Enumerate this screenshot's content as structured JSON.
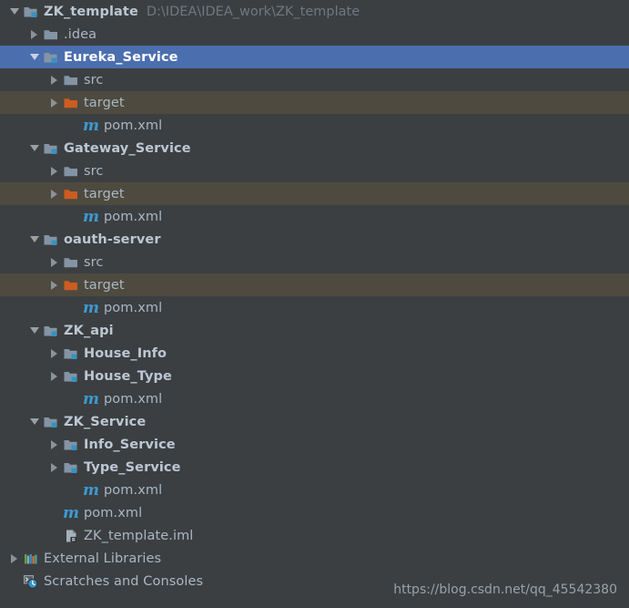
{
  "window": {
    "background_color": "#3c3f41",
    "selected_row_color": "#4b6eaf",
    "excluded_row_color": "#4e4a3f",
    "text_color": "#a9b7c6",
    "path_text_color": "#6f7780"
  },
  "watermark": "https://blog.csdn.net/qq_45542380",
  "tree": {
    "items": [
      {
        "label": "ZK_template",
        "path": "D:\\IDEA\\IDEA_work\\ZK_template",
        "icon": "module-icon",
        "depth": 0,
        "toggle": "expanded",
        "bold": true,
        "state": "normal"
      },
      {
        "label": ".idea",
        "icon": "folder-icon",
        "depth": 1,
        "toggle": "collapsed",
        "bold": false,
        "state": "normal"
      },
      {
        "label": "Eureka_Service",
        "icon": "module-icon",
        "depth": 1,
        "toggle": "expanded",
        "bold": true,
        "state": "selected"
      },
      {
        "label": "src",
        "icon": "folder-icon",
        "depth": 2,
        "toggle": "collapsed",
        "bold": false,
        "state": "normal"
      },
      {
        "label": "target",
        "icon": "folder-excluded-icon",
        "depth": 2,
        "toggle": "collapsed",
        "bold": false,
        "state": "excluded"
      },
      {
        "label": "pom.xml",
        "icon": "maven-icon",
        "depth": 3,
        "toggle": "none",
        "bold": false,
        "state": "normal"
      },
      {
        "label": "Gateway_Service",
        "icon": "module-icon",
        "depth": 1,
        "toggle": "expanded",
        "bold": true,
        "state": "normal"
      },
      {
        "label": "src",
        "icon": "folder-icon",
        "depth": 2,
        "toggle": "collapsed",
        "bold": false,
        "state": "normal"
      },
      {
        "label": "target",
        "icon": "folder-excluded-icon",
        "depth": 2,
        "toggle": "collapsed",
        "bold": false,
        "state": "excluded"
      },
      {
        "label": "pom.xml",
        "icon": "maven-icon",
        "depth": 3,
        "toggle": "none",
        "bold": false,
        "state": "normal"
      },
      {
        "label": "oauth-server",
        "icon": "module-icon",
        "depth": 1,
        "toggle": "expanded",
        "bold": true,
        "state": "normal"
      },
      {
        "label": "src",
        "icon": "folder-icon",
        "depth": 2,
        "toggle": "collapsed",
        "bold": false,
        "state": "normal"
      },
      {
        "label": "target",
        "icon": "folder-excluded-icon",
        "depth": 2,
        "toggle": "collapsed",
        "bold": false,
        "state": "excluded"
      },
      {
        "label": "pom.xml",
        "icon": "maven-icon",
        "depth": 3,
        "toggle": "none",
        "bold": false,
        "state": "normal"
      },
      {
        "label": "ZK_api",
        "icon": "module-icon",
        "depth": 1,
        "toggle": "expanded",
        "bold": true,
        "state": "normal"
      },
      {
        "label": "House_Info",
        "icon": "module-icon",
        "depth": 2,
        "toggle": "collapsed",
        "bold": true,
        "state": "normal"
      },
      {
        "label": "House_Type",
        "icon": "module-icon",
        "depth": 2,
        "toggle": "collapsed",
        "bold": true,
        "state": "normal"
      },
      {
        "label": "pom.xml",
        "icon": "maven-icon",
        "depth": 3,
        "toggle": "none",
        "bold": false,
        "state": "normal"
      },
      {
        "label": "ZK_Service",
        "icon": "module-icon",
        "depth": 1,
        "toggle": "expanded",
        "bold": true,
        "state": "normal"
      },
      {
        "label": "Info_Service",
        "icon": "module-icon",
        "depth": 2,
        "toggle": "collapsed",
        "bold": true,
        "state": "normal"
      },
      {
        "label": "Type_Service",
        "icon": "module-icon",
        "depth": 2,
        "toggle": "collapsed",
        "bold": true,
        "state": "normal"
      },
      {
        "label": "pom.xml",
        "icon": "maven-icon",
        "depth": 3,
        "toggle": "none",
        "bold": false,
        "state": "normal"
      },
      {
        "label": "pom.xml",
        "icon": "maven-icon",
        "depth": 2,
        "toggle": "none",
        "bold": false,
        "state": "normal"
      },
      {
        "label": "ZK_template.iml",
        "icon": "iml-file-icon",
        "depth": 2,
        "toggle": "none",
        "bold": false,
        "state": "normal"
      },
      {
        "label": "External Libraries",
        "icon": "libraries-icon",
        "depth": 0,
        "toggle": "collapsed",
        "bold": false,
        "state": "normal"
      },
      {
        "label": "Scratches and Consoles",
        "icon": "scratches-icon",
        "depth": 0,
        "toggle": "none",
        "bold": false,
        "state": "normal"
      }
    ]
  }
}
